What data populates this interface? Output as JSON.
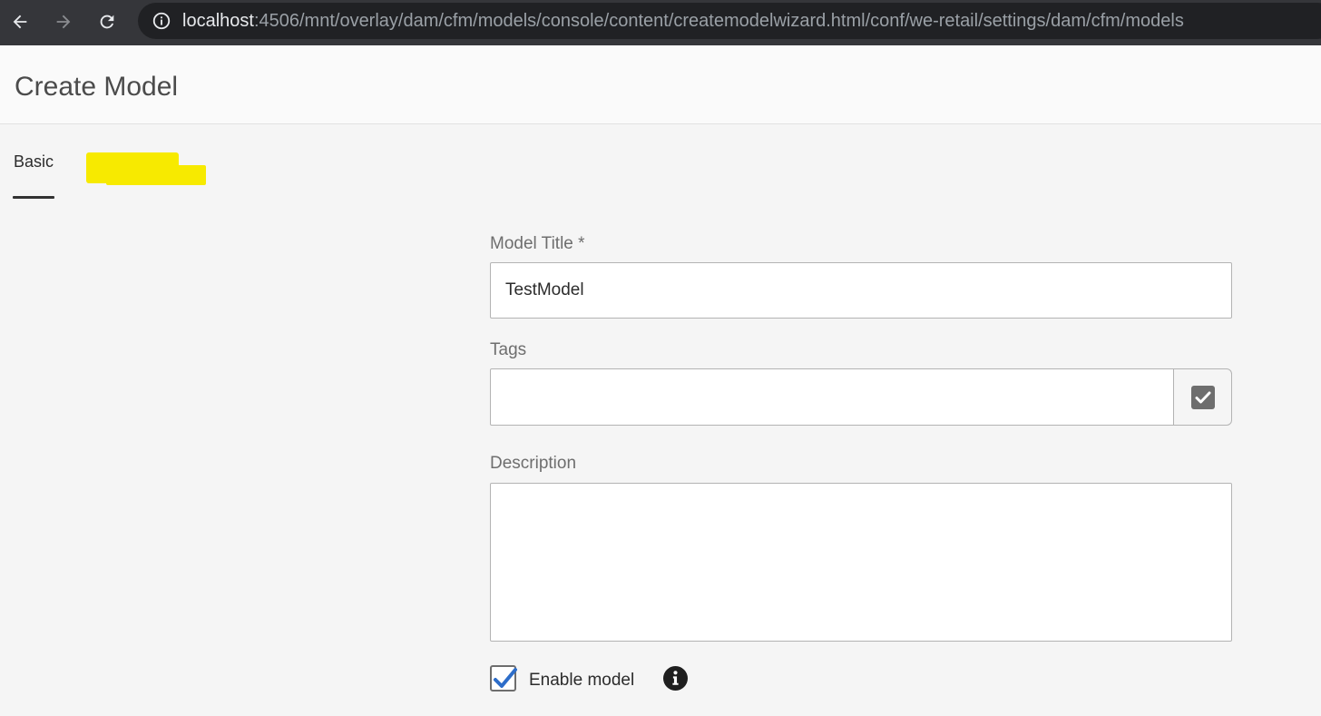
{
  "browser": {
    "url_host": "localhost",
    "url_rest": ":4506/mnt/overlay/dam/cfm/models/console/content/createmodelwizard.html/conf/we-retail/settings/dam/cfm/models",
    "icons": [
      "back-icon",
      "forward-icon",
      "reload-icon",
      "info-icon"
    ]
  },
  "header": {
    "title": "Create Model"
  },
  "tabs": [
    {
      "label": "Basic",
      "active": true
    },
    {
      "label": "",
      "redacted": true,
      "highlight_color": "#f7ea00"
    }
  ],
  "form": {
    "title_label": "Model Title *",
    "title_value": "TestModel",
    "tags_label": "Tags",
    "tags_value": "",
    "tags_button_icon": "check-square-icon",
    "description_label": "Description",
    "description_value": "",
    "enable_label": "Enable model",
    "enable_checked": true,
    "enable_info_icon": "info-circle-icon"
  },
  "colors": {
    "checkbox_check": "#2d6dc9",
    "browser_bar": "#35363a",
    "omnibox": "#202124"
  }
}
